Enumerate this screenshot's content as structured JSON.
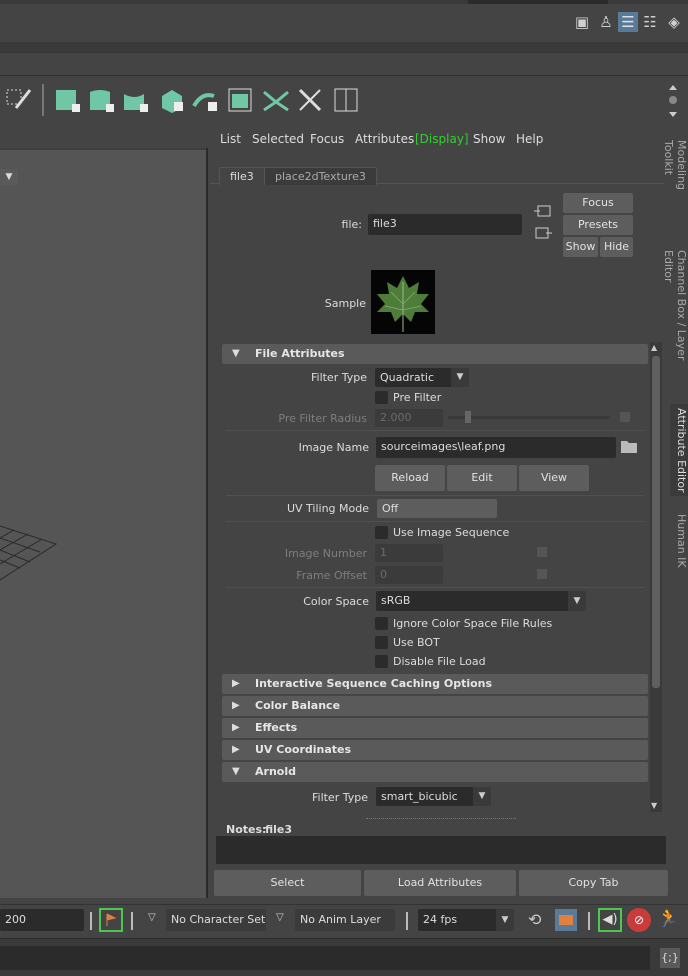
{
  "toolbar_right_icons": [
    "cube-icon",
    "person-icon",
    "attribute-editor-icon",
    "outliner-icon",
    "layers-icon"
  ],
  "shelf_icons": [
    "marquee-select-icon",
    "create-polygon-icon",
    "bevel-icon",
    "bridge-icon",
    "extrude-icon",
    "multi-cut-icon",
    "uv-editor-icon",
    "target-weld-icon",
    "sculpt-icon",
    "hud-icon"
  ],
  "attribute_editor": {
    "menu": [
      "List",
      "Selected",
      "Focus",
      "Attributes",
      "[Display]",
      "Show",
      "Help"
    ],
    "highlight_menu": "[Display]",
    "tabs": [
      "file3",
      "place2dTexture3"
    ],
    "file_label": "file:",
    "file_value": "file3",
    "buttons": {
      "focus": "Focus",
      "presets": "Presets",
      "show": "Show",
      "hide": "Hide"
    },
    "sample_label": "Sample",
    "sections": {
      "file_attributes": "File Attributes",
      "interactive": "Interactive Sequence Caching Options",
      "color_balance": "Color Balance",
      "effects": "Effects",
      "uv_coordinates": "UV Coordinates",
      "arnold": "Arnold"
    },
    "filter_type_label": "Filter Type",
    "filter_type_value": "Quadratic",
    "pre_filter_label": "Pre Filter",
    "pre_filter_radius_label": "Pre Filter Radius",
    "pre_filter_radius_value": "2.000",
    "image_name_label": "Image Name",
    "image_name_value": "sourceimages\\leaf.png",
    "reload": "Reload",
    "edit": "Edit",
    "view": "View",
    "uv_tiling_label": "UV Tiling Mode",
    "uv_tiling_value": "Off",
    "use_image_sequence": "Use Image Sequence",
    "image_number_label": "Image Number",
    "image_number_value": "1",
    "frame_offset_label": "Frame Offset",
    "frame_offset_value": "0",
    "color_space_label": "Color Space",
    "color_space_value": "sRGB",
    "ignore_rules": "Ignore Color Space File Rules",
    "use_bot": "Use BOT",
    "disable_file_load": "Disable File Load",
    "arnold_filter_label": "Filter Type",
    "arnold_filter_value": "smart_bicubic",
    "notes_label": "Notes:",
    "notes_value": "file3",
    "bottom_buttons": [
      "Select",
      "Load Attributes",
      "Copy Tab"
    ]
  },
  "side_tabs": [
    "Modeling Toolkit",
    "Channel Box / Layer Editor",
    "Attribute Editor",
    "Human IK"
  ],
  "timebar": {
    "end_value": "200",
    "character_set": "No Character Set",
    "anim_layer": "No Anim Layer",
    "fps": "24 fps"
  },
  "colors": {
    "accent_green": "#6fc7a5",
    "display_highlight": "#2fd12f"
  }
}
